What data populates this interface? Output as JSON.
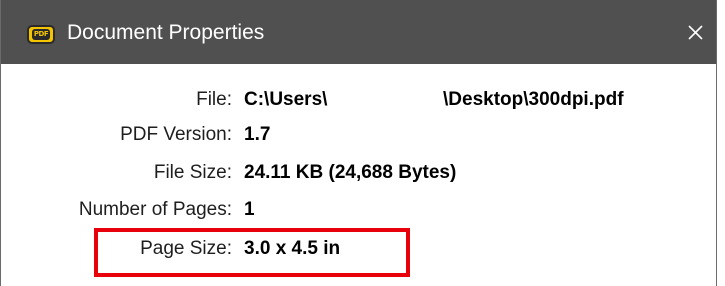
{
  "window": {
    "title": "Document Properties",
    "app_icon_text": "PDF",
    "close_glyph": "×"
  },
  "properties": [
    {
      "label": "File:",
      "value": "C:\\Users\\",
      "value_suffix": "\\Desktop\\300dpi.pdf"
    },
    {
      "label": "PDF Version:",
      "value": "1.7"
    },
    {
      "label": "File Size:",
      "value": "24.11 KB (24,688 Bytes)"
    },
    {
      "label": "Number of Pages:",
      "value": "1"
    },
    {
      "label": "Page Size:",
      "value": "3.0 x 4.5 in"
    }
  ],
  "colors": {
    "titlebar": "#505050",
    "highlight": "#e8000b",
    "icon_accent": "#f5c400"
  },
  "icons": {
    "app": "pdf-app-icon",
    "close": "close-icon"
  }
}
